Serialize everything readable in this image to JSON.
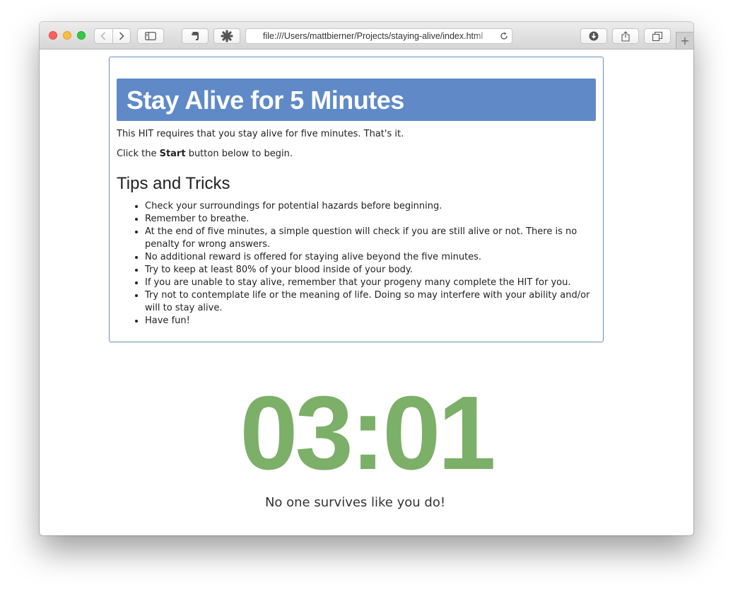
{
  "browser": {
    "url": "file:///Users/mattbierner/Projects/staying-alive/index.html",
    "new_tab_label": "+"
  },
  "page": {
    "title": "Stay Alive for 5 Minutes",
    "intro": "This HIT requires that you stay alive for five minutes. That's it.",
    "instruction_prefix": "Click the ",
    "instruction_bold": "Start",
    "instruction_suffix": " button below to begin.",
    "tips_heading": "Tips and Tricks",
    "tips": [
      "Check your surroundings for potential hazards before beginning.",
      "Remember to breathe.",
      "At the end of five minutes, a simple question will check if you are still alive or not. There is no penalty for wrong answers.",
      "No additional reward is offered for staying alive beyond the five minutes.",
      "Try to keep at least 80% of your blood inside of your body.",
      "If you are unable to stay alive, remember that your progeny many complete the HIT for you.",
      "Try not to contemplate life or the meaning of life. Doing so may interfere with your ability and/or will to stay alive.",
      "Have fun!"
    ],
    "timer": "03:01",
    "message": "No one survives like you do!"
  },
  "colors": {
    "banner": "#5f8ac7",
    "panel_border": "#6b8fb8",
    "timer": "#7caf68",
    "traffic_close": "#fc605c",
    "traffic_minimize": "#fdbc40",
    "traffic_zoom": "#34c84a"
  },
  "icons": {
    "back": "chevron-left-icon",
    "forward": "chevron-right-icon",
    "sidebar": "sidebar-icon",
    "evernote": "evernote-icon",
    "extension": "extension-icon",
    "reload": "reload-icon",
    "downloads": "download-icon",
    "share": "share-icon",
    "tabs": "tabs-overview-icon"
  }
}
